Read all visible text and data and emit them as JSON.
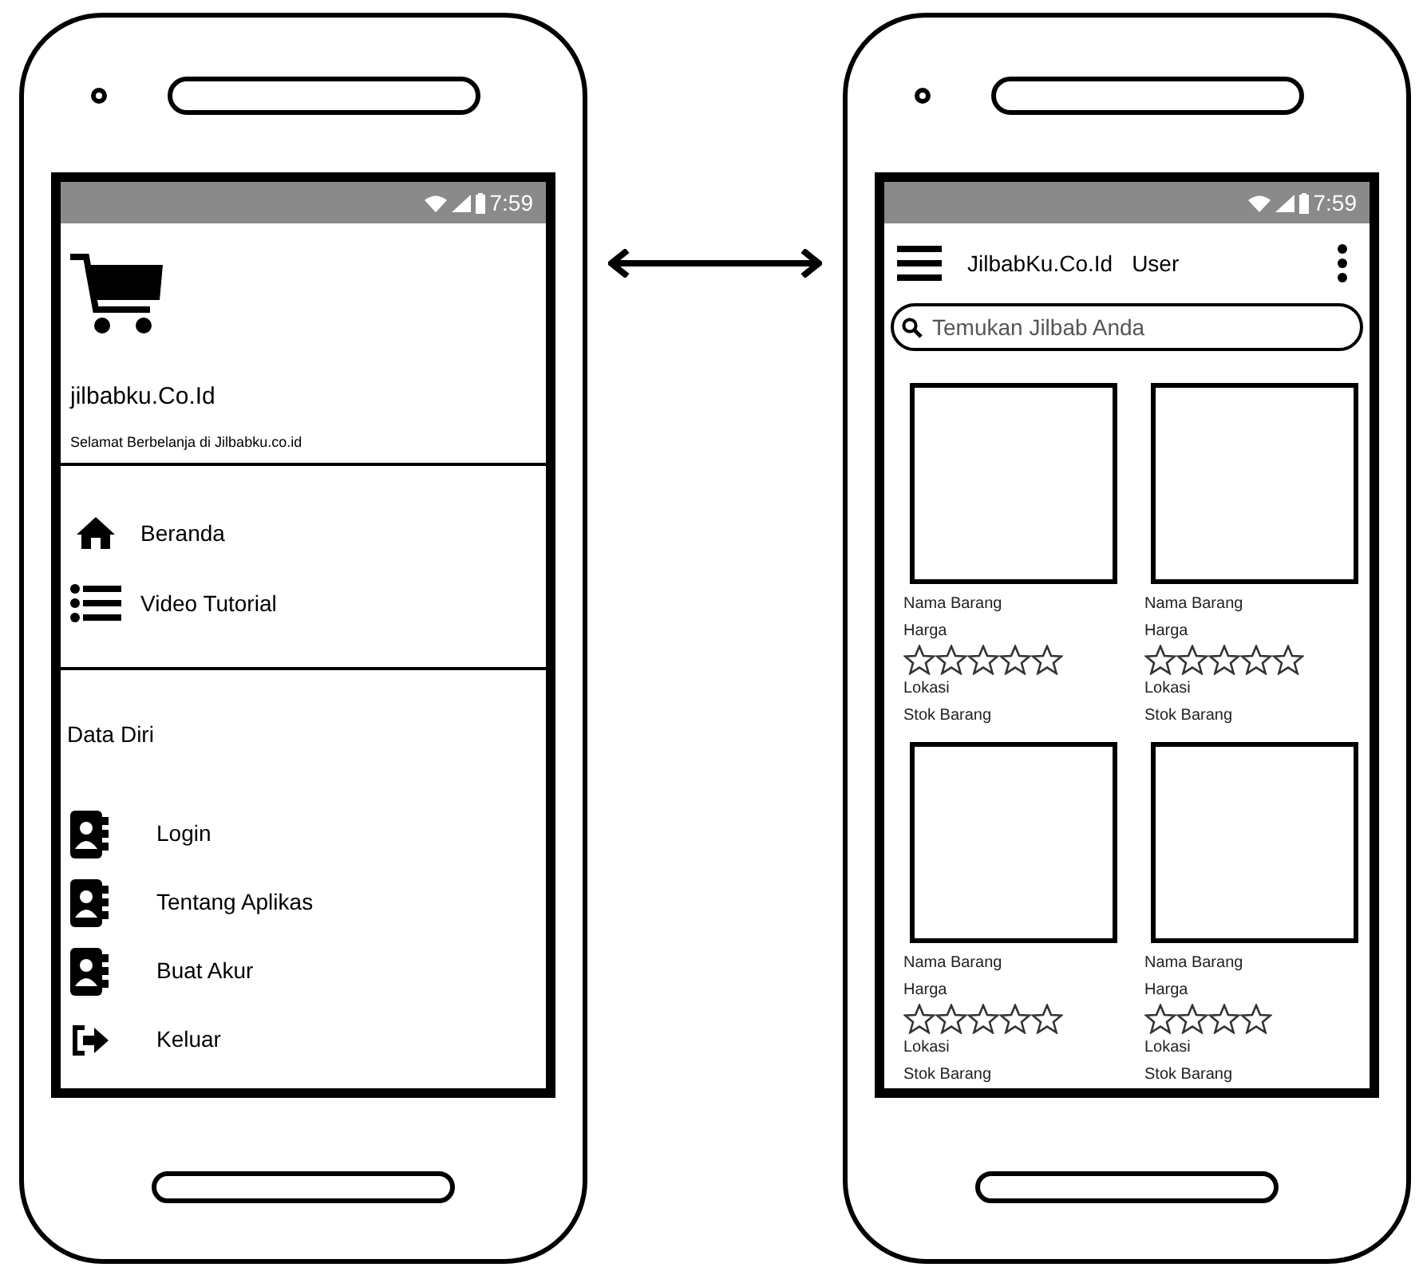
{
  "drawer_phone": {
    "status_bar": {
      "time": "7:59"
    },
    "header": {
      "title": "jilbabku.Co.Id",
      "subtitle": "Selamat Berbelanja di Jilbabku.co.id"
    },
    "menu": [
      {
        "label": "Beranda",
        "kind": "home"
      },
      {
        "label": "Video Tutorial",
        "kind": "list"
      }
    ],
    "section": {
      "title": "Data Diri",
      "items": [
        {
          "label": "Login",
          "kind": "contact"
        },
        {
          "label": "Tentang Aplikas",
          "kind": "contact"
        },
        {
          "label": "Buat Akur",
          "kind": "contact"
        },
        {
          "label": "Keluar",
          "kind": "exit"
        }
      ]
    }
  },
  "home_phone": {
    "status_bar": {
      "time": "7:59"
    },
    "app_bar": {
      "title": "JilbabKu.Co.Id",
      "subtitle": "User"
    },
    "search": {
      "placeholder": "Temukan Jilbab Anda"
    },
    "products": [
      {
        "name": "Nama Barang",
        "price": "Harga",
        "rating": [
          {
            "filled": false
          },
          {
            "filled": false
          },
          {
            "filled": false
          },
          {
            "filled": false
          },
          {
            "filled": false
          }
        ],
        "location": "Lokasi",
        "stock": "Stok Barang"
      },
      {
        "name": "Nama Barang",
        "price": "Harga",
        "rating": [
          {
            "filled": false
          },
          {
            "filled": false
          },
          {
            "filled": false
          },
          {
            "filled": false
          },
          {
            "filled": false
          }
        ],
        "location": "Lokasi",
        "stock": "Stok Barang"
      },
      {
        "name": "Nama Barang",
        "price": "Harga",
        "rating": [
          {
            "filled": false
          },
          {
            "filled": false
          },
          {
            "filled": false
          },
          {
            "filled": false
          },
          {
            "filled": false
          }
        ],
        "location": "Lokasi",
        "stock": "Stok Barang"
      },
      {
        "name": "Nama Barang",
        "price": "Harga",
        "rating": [
          {
            "filled": false
          },
          {
            "filled": false
          },
          {
            "filled": false
          },
          {
            "filled": false
          }
        ],
        "location": "Lokasi",
        "stock": "Stok Barang"
      }
    ]
  }
}
